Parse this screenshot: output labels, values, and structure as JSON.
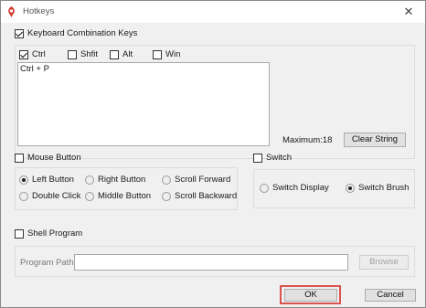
{
  "window": {
    "title": "Hotkeys",
    "close_glyph": "✕"
  },
  "keyboard": {
    "enable_label": "Keyboard Combination Keys",
    "enabled": true,
    "modifiers": [
      {
        "label": "Ctrl",
        "checked": true
      },
      {
        "label": "Shfit",
        "checked": false
      },
      {
        "label": "Alt",
        "checked": false
      },
      {
        "label": "Win",
        "checked": false
      }
    ],
    "keys_value": "Ctrl + P",
    "maximum_label": "Maximum:18",
    "clear_button": "Clear String"
  },
  "mouse": {
    "enable_label": "Mouse Button",
    "enabled": false,
    "options": [
      {
        "label": "Left Button",
        "selected": true
      },
      {
        "label": "Right Button",
        "selected": false
      },
      {
        "label": "Scroll Forward",
        "selected": false
      },
      {
        "label": "Double Click",
        "selected": false
      },
      {
        "label": "Middle Button",
        "selected": false
      },
      {
        "label": "Scroll Backward",
        "selected": false
      }
    ]
  },
  "switch": {
    "enable_label": "Switch",
    "enabled": false,
    "options": [
      {
        "label": "Switch Display",
        "selected": false
      },
      {
        "label": "Switch Brush",
        "selected": true
      }
    ]
  },
  "shell": {
    "enable_label": "Shell Program",
    "enabled": false,
    "path_label": "Program Path",
    "path_value": "",
    "browse_button": "Browse"
  },
  "footer": {
    "ok_button": "OK",
    "cancel_button": "Cancel"
  },
  "colors": {
    "highlight": "#d9534f",
    "accent": "#d43a2f"
  }
}
